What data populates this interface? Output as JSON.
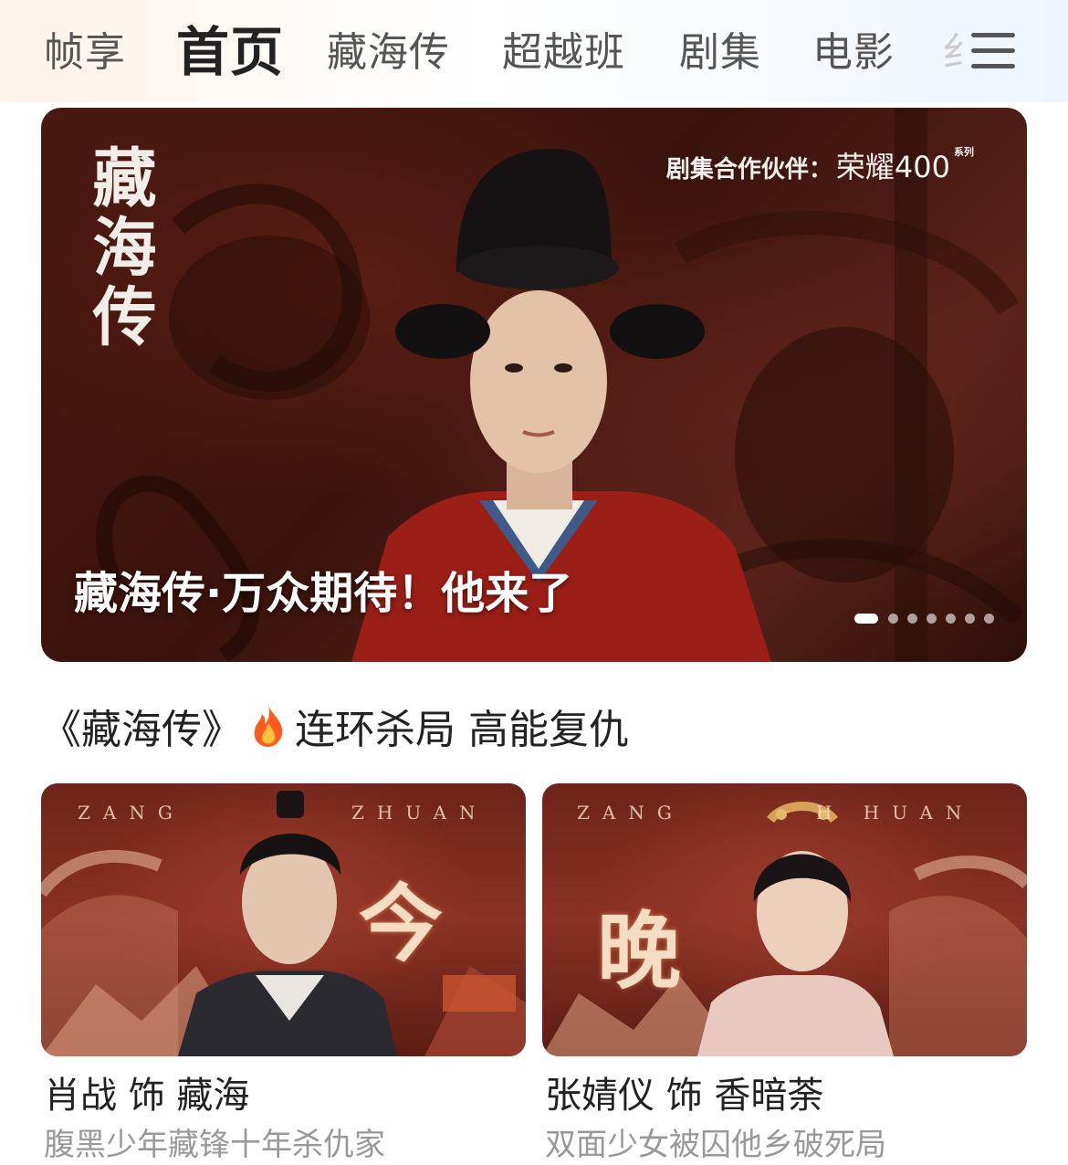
{
  "header": {
    "tabs": [
      {
        "label": "帧享",
        "active": false
      },
      {
        "label": "首页",
        "active": true
      },
      {
        "label": "藏海传",
        "active": false
      },
      {
        "label": "超越班",
        "active": false
      },
      {
        "label": "剧集",
        "active": false
      },
      {
        "label": "电影",
        "active": false
      },
      {
        "label": "纟",
        "active": false
      }
    ],
    "menu_icon": "menu-icon"
  },
  "banner": {
    "logo_text": "藏海传",
    "partner_label": "剧集合作伙伴：",
    "partner_brand": "荣耀400",
    "partner_suffix": "系列",
    "title": "藏海传·万众期待！他来了",
    "slide_count": 7,
    "active_slide": 1
  },
  "section": {
    "title_prefix": "《藏海传》",
    "flame_icon": "fire-icon",
    "title_suffix": "连环杀局 高能复仇"
  },
  "cards": [
    {
      "letters_left": "ZANG",
      "letters_right": "ZHUAN",
      "char": "今",
      "name": "肖战 饰 藏海",
      "desc": "腹黑少年藏锋十年杀仇家"
    },
    {
      "letters_left": "ZANG",
      "letters_right": "H   HUAN",
      "char": "晚",
      "name": "张婧仪 饰 香暗荼",
      "desc": "双面少女被囚他乡破死局"
    }
  ],
  "colors": {
    "banner_red": "#3a120d",
    "card_red": "#8a3224",
    "text_primary": "#222222",
    "text_secondary": "#999999"
  }
}
